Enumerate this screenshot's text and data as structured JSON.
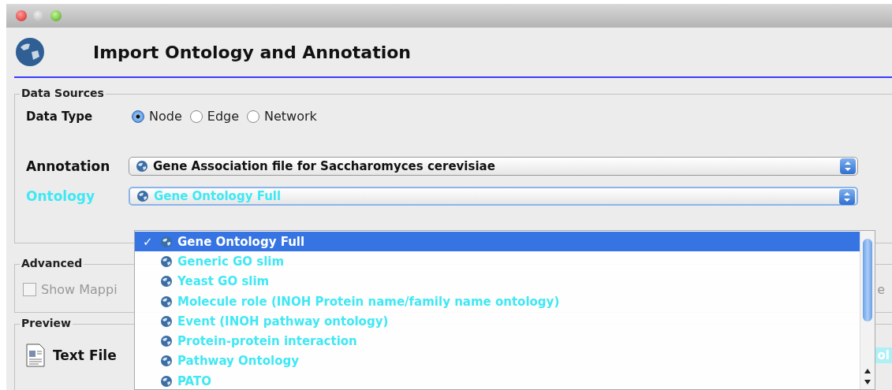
{
  "header": {
    "title": "Import Ontology and Annotation"
  },
  "data_sources": {
    "legend": "Data Sources",
    "data_type": {
      "label": "Data Type",
      "options": [
        {
          "label": "Node",
          "selected": true
        },
        {
          "label": "Edge",
          "selected": false
        },
        {
          "label": "Network",
          "selected": false
        }
      ]
    },
    "annotation": {
      "label": "Annotation",
      "value": "Gene Association file for Saccharomyces cerevisiae"
    },
    "ontology": {
      "label": "Ontology",
      "value": "Gene Ontology Full",
      "expanded": true
    }
  },
  "advanced": {
    "legend": "Advanced",
    "show_mapping": {
      "label": "Show Mappi",
      "checked": false
    },
    "case_sensitive_fragment": "e"
  },
  "preview": {
    "legend": "Preview",
    "file_label": "Text File",
    "legend_chip_fragment": "ol"
  },
  "ontology_menu": {
    "check_mark": "✓",
    "items": [
      {
        "label": "Gene Ontology Full",
        "selected": true
      },
      {
        "label": "Generic GO slim",
        "selected": false
      },
      {
        "label": "Yeast GO slim",
        "selected": false
      },
      {
        "label": "Molecule role (INOH Protein name/family name ontology)",
        "selected": false
      },
      {
        "label": "Event (INOH pathway ontology)",
        "selected": false
      },
      {
        "label": "Protein-protein interaction",
        "selected": false
      },
      {
        "label": "Pathway Ontology",
        "selected": false
      },
      {
        "label": "PATO",
        "selected": false
      }
    ]
  }
}
